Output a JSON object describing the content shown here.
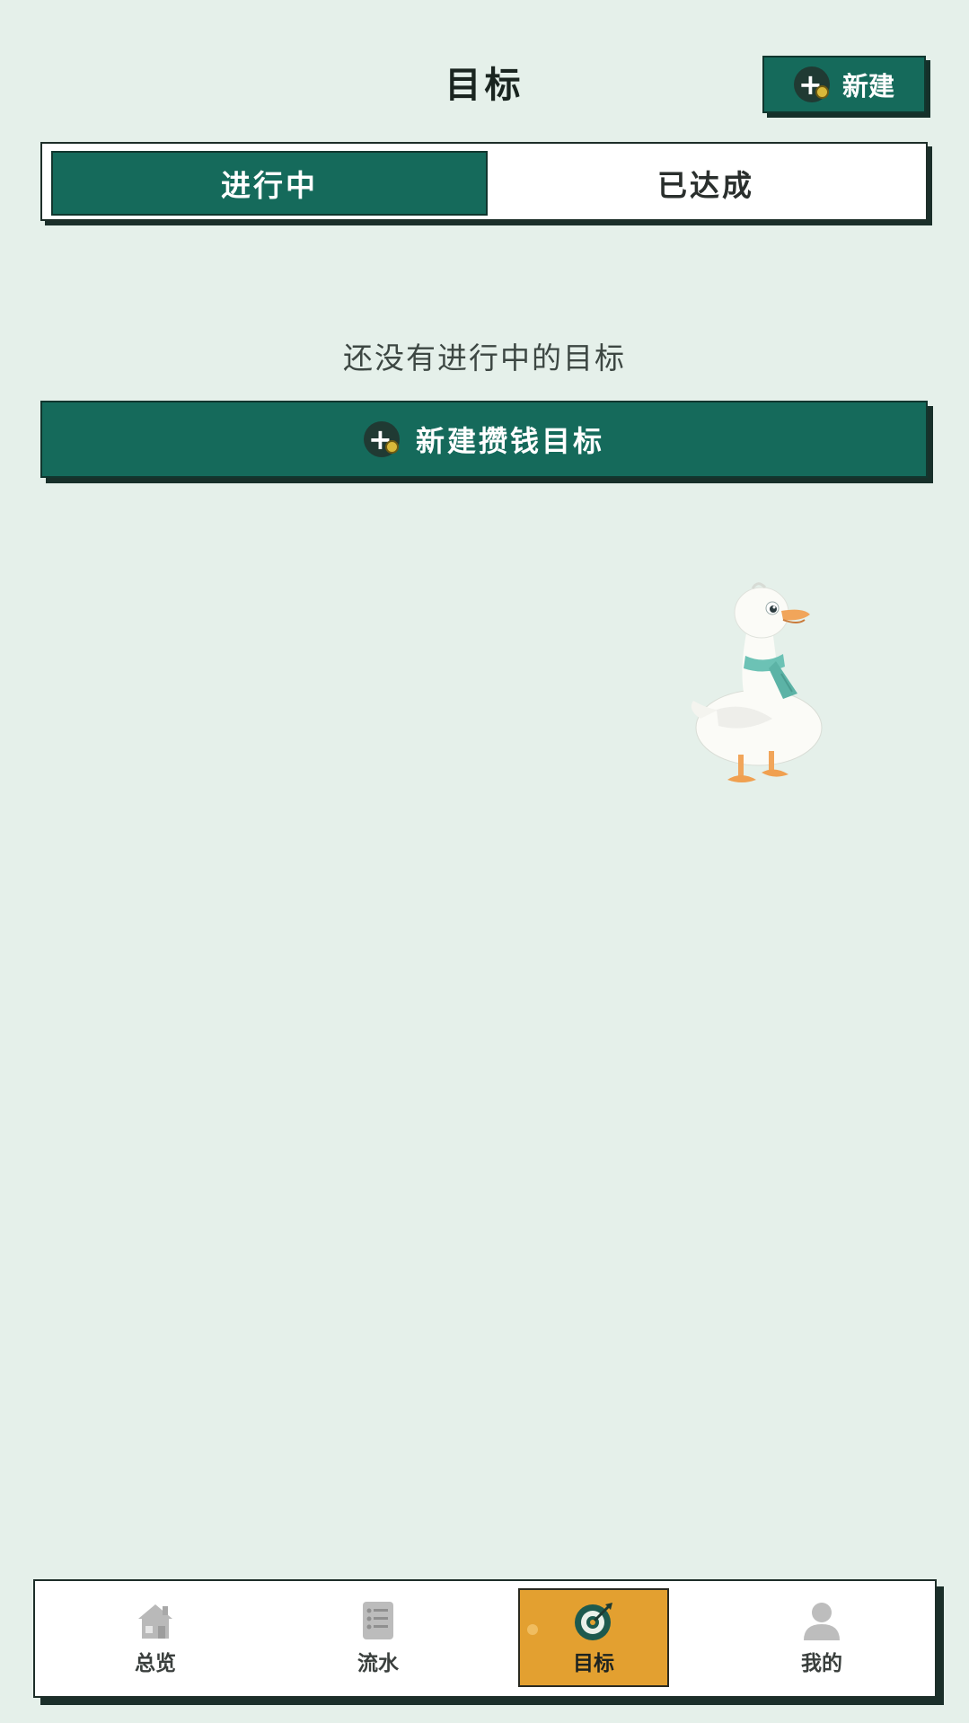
{
  "header": {
    "title": "目标",
    "new_button_label": "新建"
  },
  "tabs": {
    "active_label": "进行中",
    "inactive_label": "已达成"
  },
  "empty_state": {
    "message": "还没有进行中的目标",
    "create_button_label": "新建攒钱目标"
  },
  "bottom_nav": {
    "items": [
      {
        "label": "总览",
        "icon": "house-icon"
      },
      {
        "label": "流水",
        "icon": "list-document-icon"
      },
      {
        "label": "目标",
        "icon": "target-icon",
        "active": true
      },
      {
        "label": "我的",
        "icon": "user-icon"
      }
    ]
  },
  "colors": {
    "background": "#e5f0ea",
    "primary": "#156a5b",
    "active_nav": "#e3a030",
    "border": "#1d2e29"
  }
}
